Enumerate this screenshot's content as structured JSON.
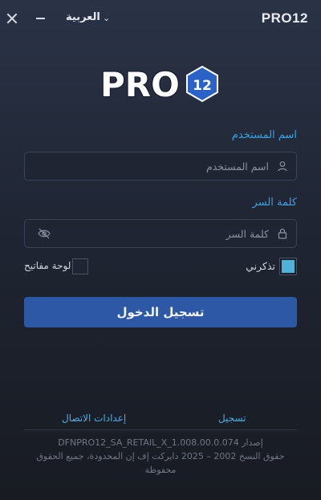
{
  "titlebar": {
    "app_title": "PRO12",
    "language": "العربية",
    "close_icon": "close-icon",
    "minimize_icon": "minimize-icon",
    "chevron_icon": "chevron-down-icon"
  },
  "logo": {
    "text": "PRO",
    "badge": "12"
  },
  "login": {
    "username_label": "اسم المستخدم",
    "username_placeholder": "اسم المستخدم",
    "password_label": "كلمة السر",
    "password_placeholder": "كلمة السر",
    "remember_label": "تذكرني",
    "remember_checked": true,
    "keyboard_label": "لوحة مفاتيح",
    "keyboard_checked": false,
    "submit_label": "تسجيل الدخول"
  },
  "links": {
    "register": "تسجيل",
    "connection_settings": "إعدادات الاتصال"
  },
  "footer": {
    "version": "إصدار DFNPRO12_SA_RETAIL_X_1.008.00.0.074",
    "copyright": "حقوق النسخ 2002 – 2025 دايركت إف إن المحدودة، جميع الحقوق",
    "reserved": "محفوظة"
  },
  "colors": {
    "accent": "#39a3e3",
    "button": "#2c58a6",
    "checkbox": "#4fb2d8"
  }
}
